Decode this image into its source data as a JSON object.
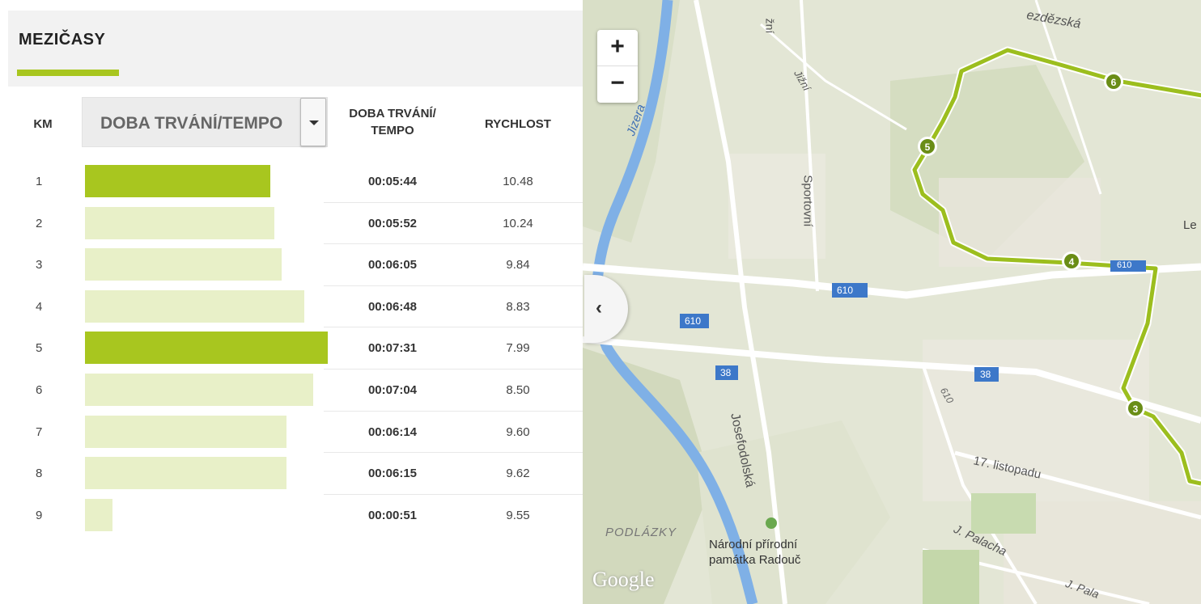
{
  "panel": {
    "title": "MEZIČASY",
    "col_km": "KM",
    "dropdown_selected": "DOBA TRVÁNÍ/TEMPO",
    "col_duration_line1": "DOBA TRVÁNÍ/",
    "col_duration_line2": "TEMPO",
    "col_speed": "RYCHLOST"
  },
  "splits": [
    {
      "km": "1",
      "duration": "00:05:44",
      "speed": "10.48",
      "bar_seconds": 344,
      "highlight": "fastest"
    },
    {
      "km": "2",
      "duration": "00:05:52",
      "speed": "10.24",
      "bar_seconds": 352,
      "highlight": "none"
    },
    {
      "km": "3",
      "duration": "00:06:05",
      "speed": "9.84",
      "bar_seconds": 365,
      "highlight": "none"
    },
    {
      "km": "4",
      "duration": "00:06:48",
      "speed": "8.83",
      "bar_seconds": 408,
      "highlight": "none"
    },
    {
      "km": "5",
      "duration": "00:07:31",
      "speed": "7.99",
      "bar_seconds": 451,
      "highlight": "slowest"
    },
    {
      "km": "6",
      "duration": "00:07:04",
      "speed": "8.50",
      "bar_seconds": 424,
      "highlight": "none"
    },
    {
      "km": "7",
      "duration": "00:06:14",
      "speed": "9.60",
      "bar_seconds": 374,
      "highlight": "none"
    },
    {
      "km": "8",
      "duration": "00:06:15",
      "speed": "9.62",
      "bar_seconds": 375,
      "highlight": "none"
    },
    {
      "km": "9",
      "duration": "00:00:51",
      "speed": "9.55",
      "bar_seconds": 51,
      "highlight": "none"
    }
  ],
  "colors": {
    "accent": "#a8c61f",
    "bar_light": "#e8f0c8",
    "bar_dark": "#a8c61f",
    "route": "#9cbe1e"
  },
  "map": {
    "zoom_in": "+",
    "zoom_out": "−",
    "collapse_icon": "‹",
    "labels": {
      "street_top": "ezdězská",
      "juzni": "žní",
      "jizni": "Jižní",
      "jizera": "Jizera",
      "sportovni": "Sportovní",
      "road610_a": "610",
      "road610_b": "610",
      "road610_c": "610",
      "road610_d": "610",
      "road38_a": "38",
      "road38_b": "38",
      "josefodolska": "Josefodolská",
      "listopadu": "17. listopadu",
      "palacha1": "J. Palacha",
      "palacha2": "J. Pala",
      "podlazky": "PODLÁZKY",
      "park_line1": "Národní přírodní",
      "park_line2": "památka Radouč",
      "le": "Le",
      "google": "Google"
    },
    "markers": [
      "6",
      "5",
      "4",
      "3"
    ]
  }
}
